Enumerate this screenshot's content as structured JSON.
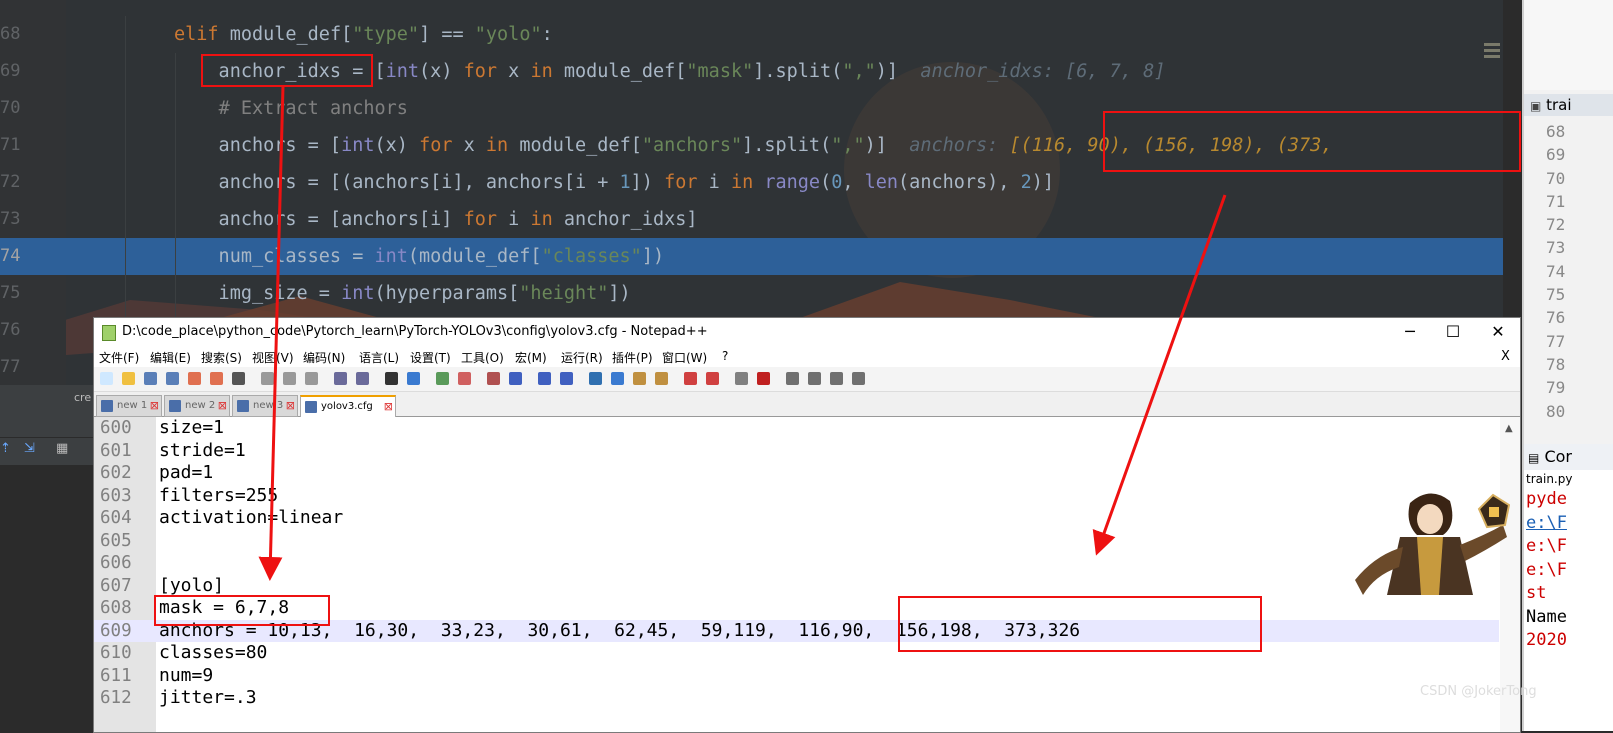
{
  "colors": {
    "annotation": "#ee1111",
    "selection": "#2d6099",
    "keyword": "#cc7832",
    "string": "#6a8759",
    "number": "#6897bb"
  },
  "ide": {
    "lines": [
      {
        "n": "68",
        "code": [
          {
            "t": "elif ",
            "c": "kw"
          },
          {
            "t": "module_def["
          },
          {
            "t": "\"type\"",
            "c": "str"
          },
          {
            "t": "] == "
          },
          {
            "t": "\"yolo\"",
            "c": "str"
          },
          {
            "t": ":"
          }
        ]
      },
      {
        "n": "69",
        "code": [
          {
            "t": "    anchor_idxs = ["
          },
          {
            "t": "int",
            "c": "bi"
          },
          {
            "t": "(x) "
          },
          {
            "t": "for ",
            "c": "kw"
          },
          {
            "t": "x "
          },
          {
            "t": "in ",
            "c": "kw"
          },
          {
            "t": "module_def["
          },
          {
            "t": "\"mask\"",
            "c": "str"
          },
          {
            "t": "].split("
          },
          {
            "t": "\",\"",
            "c": "str"
          },
          {
            "t": ")]  "
          },
          {
            "t": "anchor_idxs: [6, 7, 8]",
            "c": "hint"
          }
        ]
      },
      {
        "n": "70",
        "code": [
          {
            "t": "    "
          },
          {
            "t": "# Extract anchors",
            "c": "cm"
          }
        ]
      },
      {
        "n": "71",
        "code": [
          {
            "t": "    anchors = ["
          },
          {
            "t": "int",
            "c": "bi"
          },
          {
            "t": "(x) "
          },
          {
            "t": "for ",
            "c": "kw"
          },
          {
            "t": "x "
          },
          {
            "t": "in ",
            "c": "kw"
          },
          {
            "t": "module_def["
          },
          {
            "t": "\"anchors\"",
            "c": "str"
          },
          {
            "t": "].split("
          },
          {
            "t": "\",\"",
            "c": "str"
          },
          {
            "t": ")]  "
          },
          {
            "t": "anchors: ",
            "c": "hint"
          },
          {
            "t": "[(116, 90), (156, 198), (373,",
            "c": "hintv"
          }
        ]
      },
      {
        "n": "72",
        "code": [
          {
            "t": "    anchors = [(anchors[i], anchors[i + "
          },
          {
            "t": "1",
            "c": "num"
          },
          {
            "t": "]) "
          },
          {
            "t": "for ",
            "c": "kw"
          },
          {
            "t": "i "
          },
          {
            "t": "in ",
            "c": "kw"
          },
          {
            "t": "range",
            "c": "bi"
          },
          {
            "t": "("
          },
          {
            "t": "0",
            "c": "num"
          },
          {
            "t": ", "
          },
          {
            "t": "len",
            "c": "bi"
          },
          {
            "t": "(anchors), "
          },
          {
            "t": "2",
            "c": "num"
          },
          {
            "t": ")]"
          }
        ]
      },
      {
        "n": "73",
        "code": [
          {
            "t": "    anchors = [anchors[i] "
          },
          {
            "t": "for ",
            "c": "kw"
          },
          {
            "t": "i "
          },
          {
            "t": "in ",
            "c": "kw"
          },
          {
            "t": "anchor_idxs]"
          }
        ]
      },
      {
        "n": "74",
        "code": [
          {
            "t": "    num_classes = "
          },
          {
            "t": "int",
            "c": "bi"
          },
          {
            "t": "(module_def["
          },
          {
            "t": "\"classes\"",
            "c": "str"
          },
          {
            "t": "])"
          }
        ]
      },
      {
        "n": "75",
        "code": [
          {
            "t": "    img_size = "
          },
          {
            "t": "int",
            "c": "bi"
          },
          {
            "t": "(hyperparams["
          },
          {
            "t": "\"height\"",
            "c": "str"
          },
          {
            "t": "])"
          }
        ]
      },
      {
        "n": "76",
        "code": []
      },
      {
        "n": "77",
        "code": []
      }
    ],
    "lower_tab_label": "cre"
  },
  "right_panel": {
    "tab_label": "trai",
    "line_numbers": [
      "68",
      "69",
      "70",
      "71",
      "72",
      "73",
      "74",
      "75",
      "76",
      "77",
      "78",
      "79",
      "80"
    ],
    "console_tab": "Cor",
    "console_sub": "train.py",
    "console_lines": [
      {
        "t": "pyde",
        "c": "red"
      },
      {
        "t": "e:\\F",
        "c": "blue"
      },
      {
        "t": "e:\\F",
        "c": "red"
      },
      {
        "t": "e:\\F",
        "c": "red"
      },
      {
        "t": "  st",
        "c": "red"
      },
      {
        "t": "Name",
        "c": "navy"
      },
      {
        "t": "2020",
        "c": "red"
      }
    ]
  },
  "npp": {
    "title": "D:\\code_place\\python_code\\Pytorch_learn\\PyTorch-YOLOv3\\config\\yolov3.cfg - Notepad++",
    "window_buttons": {
      "minimize": "─",
      "maximize": "☐",
      "close": "✕",
      "doc_close": "X"
    },
    "menu": [
      "文件(F)",
      "编辑(E)",
      "搜索(S)",
      "视图(V)",
      "编码(N)",
      "语言(L)",
      "设置(T)",
      "工具(O)",
      "宏(M)",
      "运行(R)",
      "插件(P)",
      "窗口(W)",
      "?"
    ],
    "tabs": [
      {
        "label": "new 1",
        "active": false
      },
      {
        "label": "new 2",
        "active": false
      },
      {
        "label": "new 3",
        "active": false
      },
      {
        "label": "yolov3.cfg",
        "active": true
      }
    ],
    "lines": [
      {
        "n": "600",
        "t": "size=1"
      },
      {
        "n": "601",
        "t": "stride=1"
      },
      {
        "n": "602",
        "t": "pad=1"
      },
      {
        "n": "603",
        "t": "filters=255"
      },
      {
        "n": "604",
        "t": "activation=linear"
      },
      {
        "n": "605",
        "t": ""
      },
      {
        "n": "606",
        "t": ""
      },
      {
        "n": "607",
        "t": "[yolo]"
      },
      {
        "n": "608",
        "t": "mask = 6,7,8"
      },
      {
        "n": "609",
        "t": "anchors = 10,13,  16,30,  33,23,  30,61,  62,45,  59,119,  116,90,  156,198,  373,326",
        "current": true
      },
      {
        "n": "610",
        "t": "classes=80"
      },
      {
        "n": "611",
        "t": "num=9"
      },
      {
        "n": "612",
        "t": "jitter=.3"
      }
    ]
  },
  "watermark": "CSDN @JokerTong"
}
